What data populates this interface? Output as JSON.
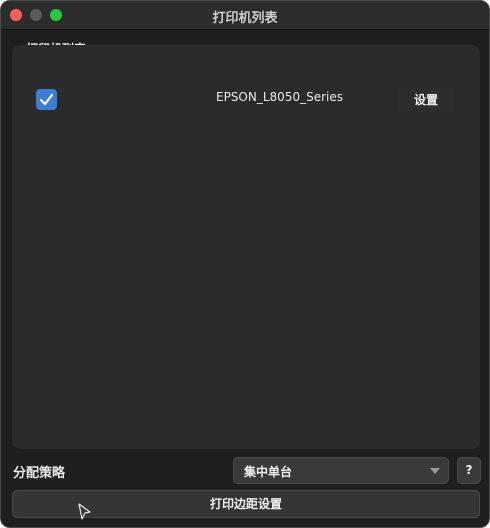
{
  "window": {
    "title": "打印机列表"
  },
  "printers_group": {
    "label": "打印机列表",
    "items": [
      {
        "checked": true,
        "name": "EPSON_L8050_Series",
        "settings_label": "设置"
      }
    ]
  },
  "strategy": {
    "label": "分配策略",
    "selected": "集中单台",
    "help_label": "?"
  },
  "footer": {
    "margin_button_label": "打印边距设置"
  },
  "colors": {
    "accent": "#3c7ed3",
    "close": "#ff5f57",
    "zoom": "#28c840",
    "background": "#1f1f1f",
    "panel": "#2b2b2b"
  }
}
